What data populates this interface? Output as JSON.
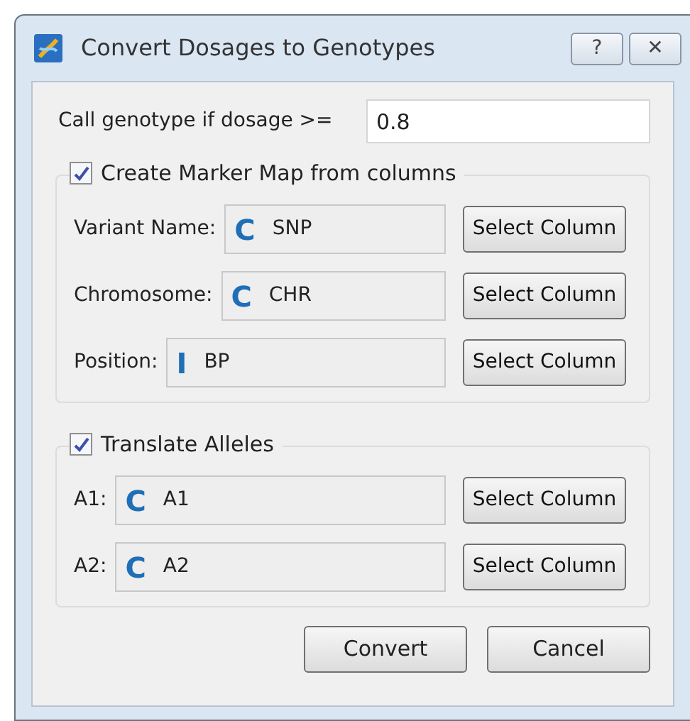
{
  "window": {
    "title": "Convert Dosages to Genotypes",
    "buttons": [
      "?",
      "✕"
    ]
  },
  "threshold": {
    "label": "Call genotype if dosage >=",
    "value": "0.8"
  },
  "groups": [
    {
      "title": "Create Marker Map from columns",
      "checked": true,
      "rows": [
        {
          "label": "Variant Name:",
          "type_icon": "C",
          "value": "SNP",
          "button": "Select Column"
        },
        {
          "label": "Chromosome:",
          "type_icon": "C",
          "value": "CHR",
          "button": "Select Column"
        },
        {
          "label": "Position:",
          "type_icon": "I",
          "value": "BP",
          "button": "Select Column"
        }
      ]
    },
    {
      "title": "Translate Alleles",
      "checked": true,
      "rows": [
        {
          "label": "A1:",
          "type_icon": "C",
          "value": "A1",
          "button": "Select Column"
        },
        {
          "label": "A2:",
          "type_icon": "C",
          "value": "A2",
          "button": "Select Column"
        }
      ]
    }
  ],
  "buttons": [
    "Convert",
    "Cancel"
  ]
}
